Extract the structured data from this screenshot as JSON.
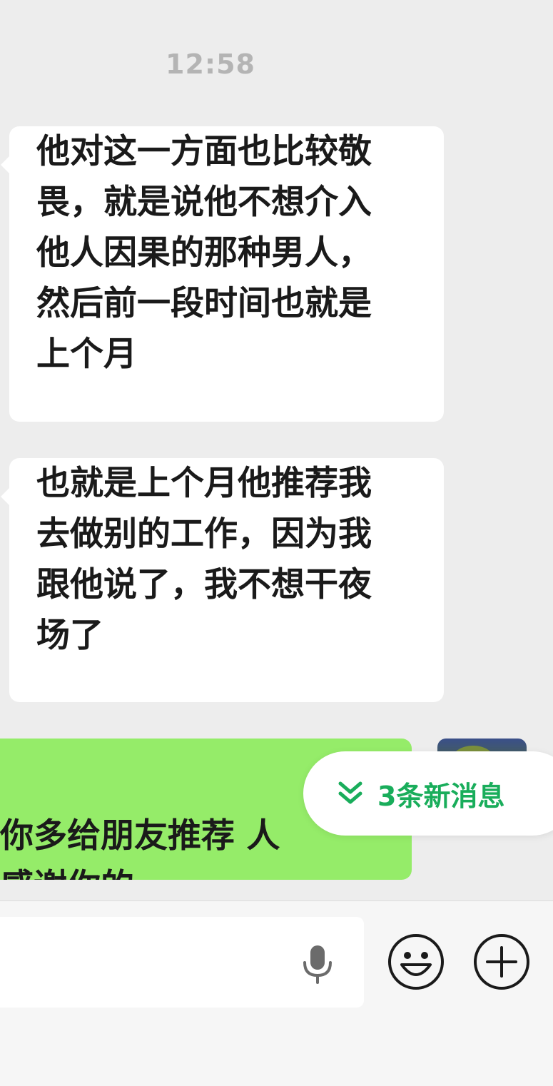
{
  "chat": {
    "timestamp": "12:58",
    "messages": [
      {
        "direction": "incoming",
        "text": "他对这一方面也比较敬\n畏，就是说他不想介入\n他人因果的那种男人，\n然后前一段时间也就是\n上个月"
      },
      {
        "direction": "incoming",
        "text": "也就是上个月他推荐我\n去做别的工作，因为我\n跟他说了，我不想干夜\n场了"
      },
      {
        "direction": "outgoing",
        "text": "你多给朋友推荐 人\n感谢你的"
      }
    ],
    "new_messages_label": "3条新消息"
  },
  "input_bar": {
    "icons": {
      "voice": "mic-icon",
      "emoji": "emoji-icon",
      "more": "plus-icon"
    }
  },
  "colors": {
    "background": "#ededed",
    "incoming_bubble": "#ffffff",
    "outgoing_bubble": "#95ec69",
    "accent_green": "#19ad5b",
    "timestamp_gray": "#b4b4b4"
  }
}
